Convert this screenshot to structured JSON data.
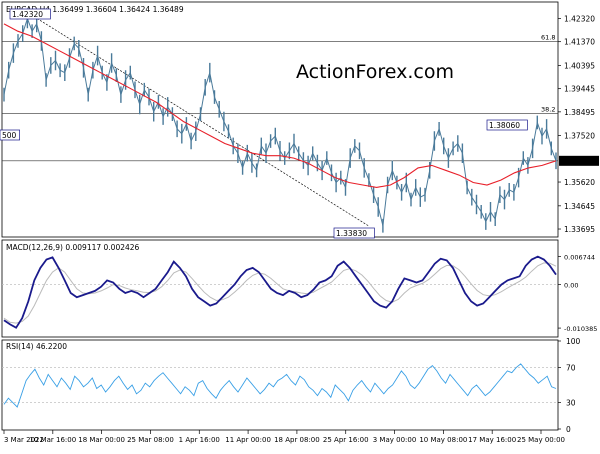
{
  "header": {
    "symbol_info": "EURCAD,H4  1.36499 1.36604 1.36424 1.36489"
  },
  "watermark": "ActionForex.com",
  "colors": {
    "price": "#4a7a9a",
    "ma": "#e8202a",
    "trendline": "#111111",
    "macd": "#1a1a8c",
    "signal": "#bbbbbb",
    "rsi": "#3aa0e6",
    "fib": "#333333",
    "grid": "#c0c0c0",
    "watermark": "#dcdcdc"
  },
  "chart_data": [
    {
      "type": "line",
      "name": "price",
      "y_ticks": [
        "1.42320",
        "1.41370",
        "1.40395",
        "1.39445",
        "1.38495",
        "1.37520",
        "1.36489",
        "1.35620",
        "1.34645",
        "1.33695"
      ],
      "ylim": [
        1.3345,
        1.4275
      ],
      "price_series": [
        1.392,
        1.402,
        1.409,
        1.414,
        1.417,
        1.4232,
        1.418,
        1.421,
        1.414,
        1.398,
        1.404,
        1.406,
        1.402,
        1.401,
        1.407,
        1.413,
        1.411,
        1.403,
        1.392,
        1.402,
        1.408,
        1.401,
        1.397,
        1.405,
        1.4,
        1.392,
        1.398,
        1.401,
        1.394,
        1.388,
        1.394,
        1.391,
        1.385,
        1.389,
        1.383,
        1.387,
        1.384,
        1.378,
        1.376,
        1.38,
        1.373,
        1.377,
        1.384,
        1.395,
        1.401,
        1.391,
        1.386,
        1.381,
        1.377,
        1.371,
        1.368,
        1.362,
        1.368,
        1.364,
        1.361,
        1.371,
        1.368,
        1.373,
        1.375,
        1.369,
        1.366,
        1.369,
        1.372,
        1.368,
        1.365,
        1.363,
        1.368,
        1.364,
        1.361,
        1.366,
        1.36,
        1.356,
        1.358,
        1.354,
        1.366,
        1.371,
        1.369,
        1.362,
        1.357,
        1.351,
        1.346,
        1.3383,
        1.355,
        1.361,
        1.356,
        1.352,
        1.356,
        1.349,
        1.354,
        1.35,
        1.351,
        1.361,
        1.373,
        1.378,
        1.371,
        1.366,
        1.37,
        1.372,
        1.368,
        1.354,
        1.35,
        1.347,
        1.344,
        1.34,
        1.344,
        1.341,
        1.351,
        1.349,
        1.353,
        1.352,
        1.358,
        1.366,
        1.363,
        1.37,
        1.3806,
        1.375,
        1.378,
        1.37,
        1.3649
      ],
      "ma_series": [
        1.421,
        1.418,
        1.416,
        1.413,
        1.41,
        1.407,
        1.404,
        1.401,
        1.398,
        1.395,
        1.392,
        1.389,
        1.385,
        1.381,
        1.378,
        1.375,
        1.372,
        1.37,
        1.368,
        1.367,
        1.367,
        1.366,
        1.364,
        1.361,
        1.358,
        1.356,
        1.355,
        1.354,
        1.355,
        1.358,
        1.362,
        1.363,
        1.361,
        1.359,
        1.356,
        1.355,
        1.357,
        1.36,
        1.362,
        1.363,
        1.3649
      ],
      "fib_levels": [
        {
          "label": "61.8",
          "value": 1.4137
        },
        {
          "label": "38.2",
          "value": 1.3842
        },
        {
          "label": "",
          "value": 1.3649
        }
      ],
      "annotations": [
        "1.42320",
        "1.33830",
        "1.38060",
        "500"
      ],
      "current_label": "1.36489",
      "trendline": [
        {
          "x": 0.06,
          "y": 1.4232
        },
        {
          "x": 0.66,
          "y": 1.3383
        }
      ]
    },
    {
      "type": "line",
      "name": "MACD(12,26,9) 0.009117 0.002426",
      "y_ticks": [
        "0.006744",
        "0.00",
        "-0.010385"
      ],
      "ylim": [
        -0.0118,
        0.0078
      ],
      "macd_series": [
        -0.0085,
        -0.0095,
        -0.0103,
        -0.008,
        -0.004,
        0.001,
        0.004,
        0.006,
        0.0065,
        0.004,
        0.001,
        -0.002,
        -0.003,
        -0.0025,
        -0.002,
        -0.0015,
        -0.0005,
        0.001,
        0.0005,
        -0.001,
        -0.002,
        -0.0015,
        -0.002,
        -0.003,
        -0.002,
        -0.001,
        0.001,
        0.003,
        0.0055,
        0.004,
        0.002,
        -0.001,
        -0.003,
        -0.004,
        -0.005,
        -0.0045,
        -0.003,
        -0.0015,
        0.0,
        0.002,
        0.0035,
        0.004,
        0.003,
        0.001,
        -0.001,
        -0.002,
        -0.0025,
        -0.0015,
        -0.002,
        -0.003,
        -0.0025,
        -0.0012,
        0.0005,
        0.001,
        0.002,
        0.0045,
        0.0055,
        0.004,
        0.002,
        0.0,
        -0.002,
        -0.004,
        -0.005,
        -0.0055,
        -0.004,
        -0.001,
        0.0015,
        0.001,
        0.0005,
        0.001,
        0.003,
        0.005,
        0.0062,
        0.0058,
        0.004,
        0.001,
        -0.002,
        -0.004,
        -0.005,
        -0.0045,
        -0.003,
        -0.0015,
        0.0,
        0.001,
        0.0015,
        0.002,
        0.0045,
        0.006,
        0.0067,
        0.006,
        0.0045,
        0.0024
      ],
      "signal_series": [
        -0.008,
        -0.009,
        -0.0092,
        -0.0088,
        -0.0075,
        -0.005,
        -0.002,
        0.001,
        0.003,
        0.004,
        0.003,
        0.001,
        -0.001,
        -0.002,
        -0.0022,
        -0.002,
        -0.0015,
        -0.0008,
        0.0,
        -0.0002,
        -0.0008,
        -0.0012,
        -0.0015,
        -0.0018,
        -0.0019,
        -0.0015,
        -0.0005,
        0.001,
        0.0028,
        0.0035,
        0.003,
        0.0015,
        -0.0002,
        -0.0018,
        -0.003,
        -0.0038,
        -0.0036,
        -0.003,
        -0.0018,
        -0.0005,
        0.001,
        0.0022,
        0.0028,
        0.0025,
        0.0015,
        0.0002,
        -0.001,
        -0.0015,
        -0.0017,
        -0.002,
        -0.0022,
        -0.0018,
        -0.001,
        -0.0002,
        0.0006,
        0.002,
        0.0034,
        0.0038,
        0.0033,
        0.0023,
        0.0008,
        -0.001,
        -0.0027,
        -0.0038,
        -0.0042,
        -0.0035,
        -0.002,
        -0.0008,
        -0.0002,
        0.0003,
        0.0012,
        0.0025,
        0.0038,
        0.0046,
        0.0045,
        0.0036,
        0.002,
        0.0002,
        -0.0014,
        -0.0024,
        -0.0027,
        -0.0024,
        -0.0017,
        -0.0008,
        0.0,
        0.0008,
        0.0018,
        0.0032,
        0.0045,
        0.0052,
        0.0051,
        0.0044
      ]
    },
    {
      "type": "line",
      "name": "RSI(14) 46.2200",
      "y_ticks": [
        "100",
        "70",
        "30",
        "0"
      ],
      "ylim": [
        0,
        100
      ],
      "levels": [
        70,
        30
      ],
      "rsi_series": [
        28,
        35,
        30,
        25,
        40,
        55,
        62,
        68,
        58,
        50,
        62,
        55,
        48,
        58,
        52,
        45,
        60,
        55,
        48,
        52,
        58,
        46,
        50,
        42,
        48,
        55,
        60,
        52,
        45,
        50,
        40,
        44,
        52,
        48,
        55,
        60,
        64,
        58,
        52,
        46,
        40,
        48,
        44,
        38,
        52,
        55,
        46,
        40,
        35,
        44,
        50,
        55,
        48,
        42,
        50,
        58,
        52,
        46,
        40,
        45,
        52,
        48,
        55,
        58,
        62,
        55,
        50,
        60,
        56,
        48,
        44,
        38,
        46,
        42,
        36,
        50,
        45,
        40,
        32,
        44,
        50,
        55,
        48,
        42,
        52,
        46,
        40,
        46,
        50,
        58,
        66,
        60,
        50,
        46,
        52,
        60,
        68,
        72,
        66,
        58,
        52,
        62,
        56,
        50,
        44,
        38,
        46,
        50,
        44,
        38,
        42,
        48,
        54,
        60,
        66,
        64,
        70,
        74,
        68,
        62,
        58,
        52,
        56,
        60,
        48,
        46
      ]
    }
  ],
  "x_axis_labels": [
    "3 Mar 2022",
    "10 Mar 16:00",
    "18 Mar 00:00",
    "25 Mar 08:00",
    "1 Apr 16:00",
    "11 Apr 00:00",
    "18 Apr 08:00",
    "25 Apr 16:00",
    "3 May 00:00",
    "10 May 08:00",
    "17 May 16:00",
    "25 May 00:00"
  ]
}
